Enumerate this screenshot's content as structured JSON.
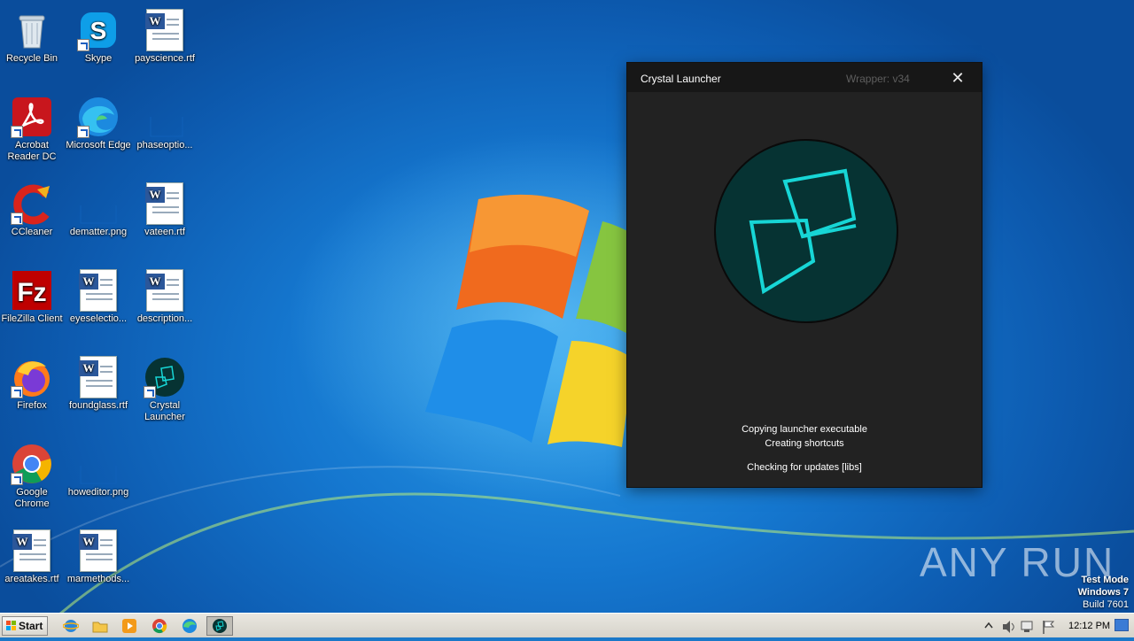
{
  "desktop": {
    "icons": [
      {
        "label": "Recycle Bin",
        "icon": "recycle-bin-icon"
      },
      {
        "label": "Skype",
        "icon": "skype-icon"
      },
      {
        "label": "payscience.rtf",
        "icon": "word-document-icon"
      },
      {
        "label": "Acrobat Reader DC",
        "icon": "acrobat-reader-icon"
      },
      {
        "label": "Microsoft Edge",
        "icon": "edge-icon"
      },
      {
        "label": "phaseoptio...",
        "icon": "image-file-icon"
      },
      {
        "label": "CCleaner",
        "icon": "ccleaner-icon"
      },
      {
        "label": "dematter.png",
        "icon": "image-file-icon"
      },
      {
        "label": "vateen.rtf",
        "icon": "word-document-icon"
      },
      {
        "label": "FileZilla Client",
        "icon": "filezilla-icon"
      },
      {
        "label": "eyeselectio...",
        "icon": "word-document-icon"
      },
      {
        "label": "description...",
        "icon": "word-document-icon"
      },
      {
        "label": "Firefox",
        "icon": "firefox-icon"
      },
      {
        "label": "foundglass.rtf",
        "icon": "word-document-icon"
      },
      {
        "label": "Crystal Launcher",
        "icon": "crystal-launcher-icon"
      },
      {
        "label": "Google Chrome",
        "icon": "chrome-icon"
      },
      {
        "label": "howeditor.png",
        "icon": "image-file-icon"
      },
      {
        "label": "areatakes.rtf",
        "icon": "word-document-icon"
      },
      {
        "label": "marmethods...",
        "icon": "word-document-icon"
      }
    ]
  },
  "window": {
    "title": "Crystal Launcher",
    "wrapper": "Wrapper: v34",
    "close_glyph": "✕",
    "status_lines": [
      "Copying launcher executable",
      "Creating shortcuts",
      "Checking for updates [libs]"
    ],
    "accent_color": "#17d6d6",
    "logo_bg_color": "#063333"
  },
  "taskbar": {
    "start_label": "Start",
    "pinned": [
      "internet-explorer-icon",
      "file-explorer-icon",
      "media-player-icon",
      "chrome-icon",
      "edge-icon",
      "crystal-launcher-icon"
    ],
    "clock": "12:12 PM"
  },
  "watermark": {
    "text": "ANY RUN"
  },
  "os_badge": {
    "line1": "Test Mode",
    "line2": "Windows 7",
    "line3": "Build 7601"
  }
}
